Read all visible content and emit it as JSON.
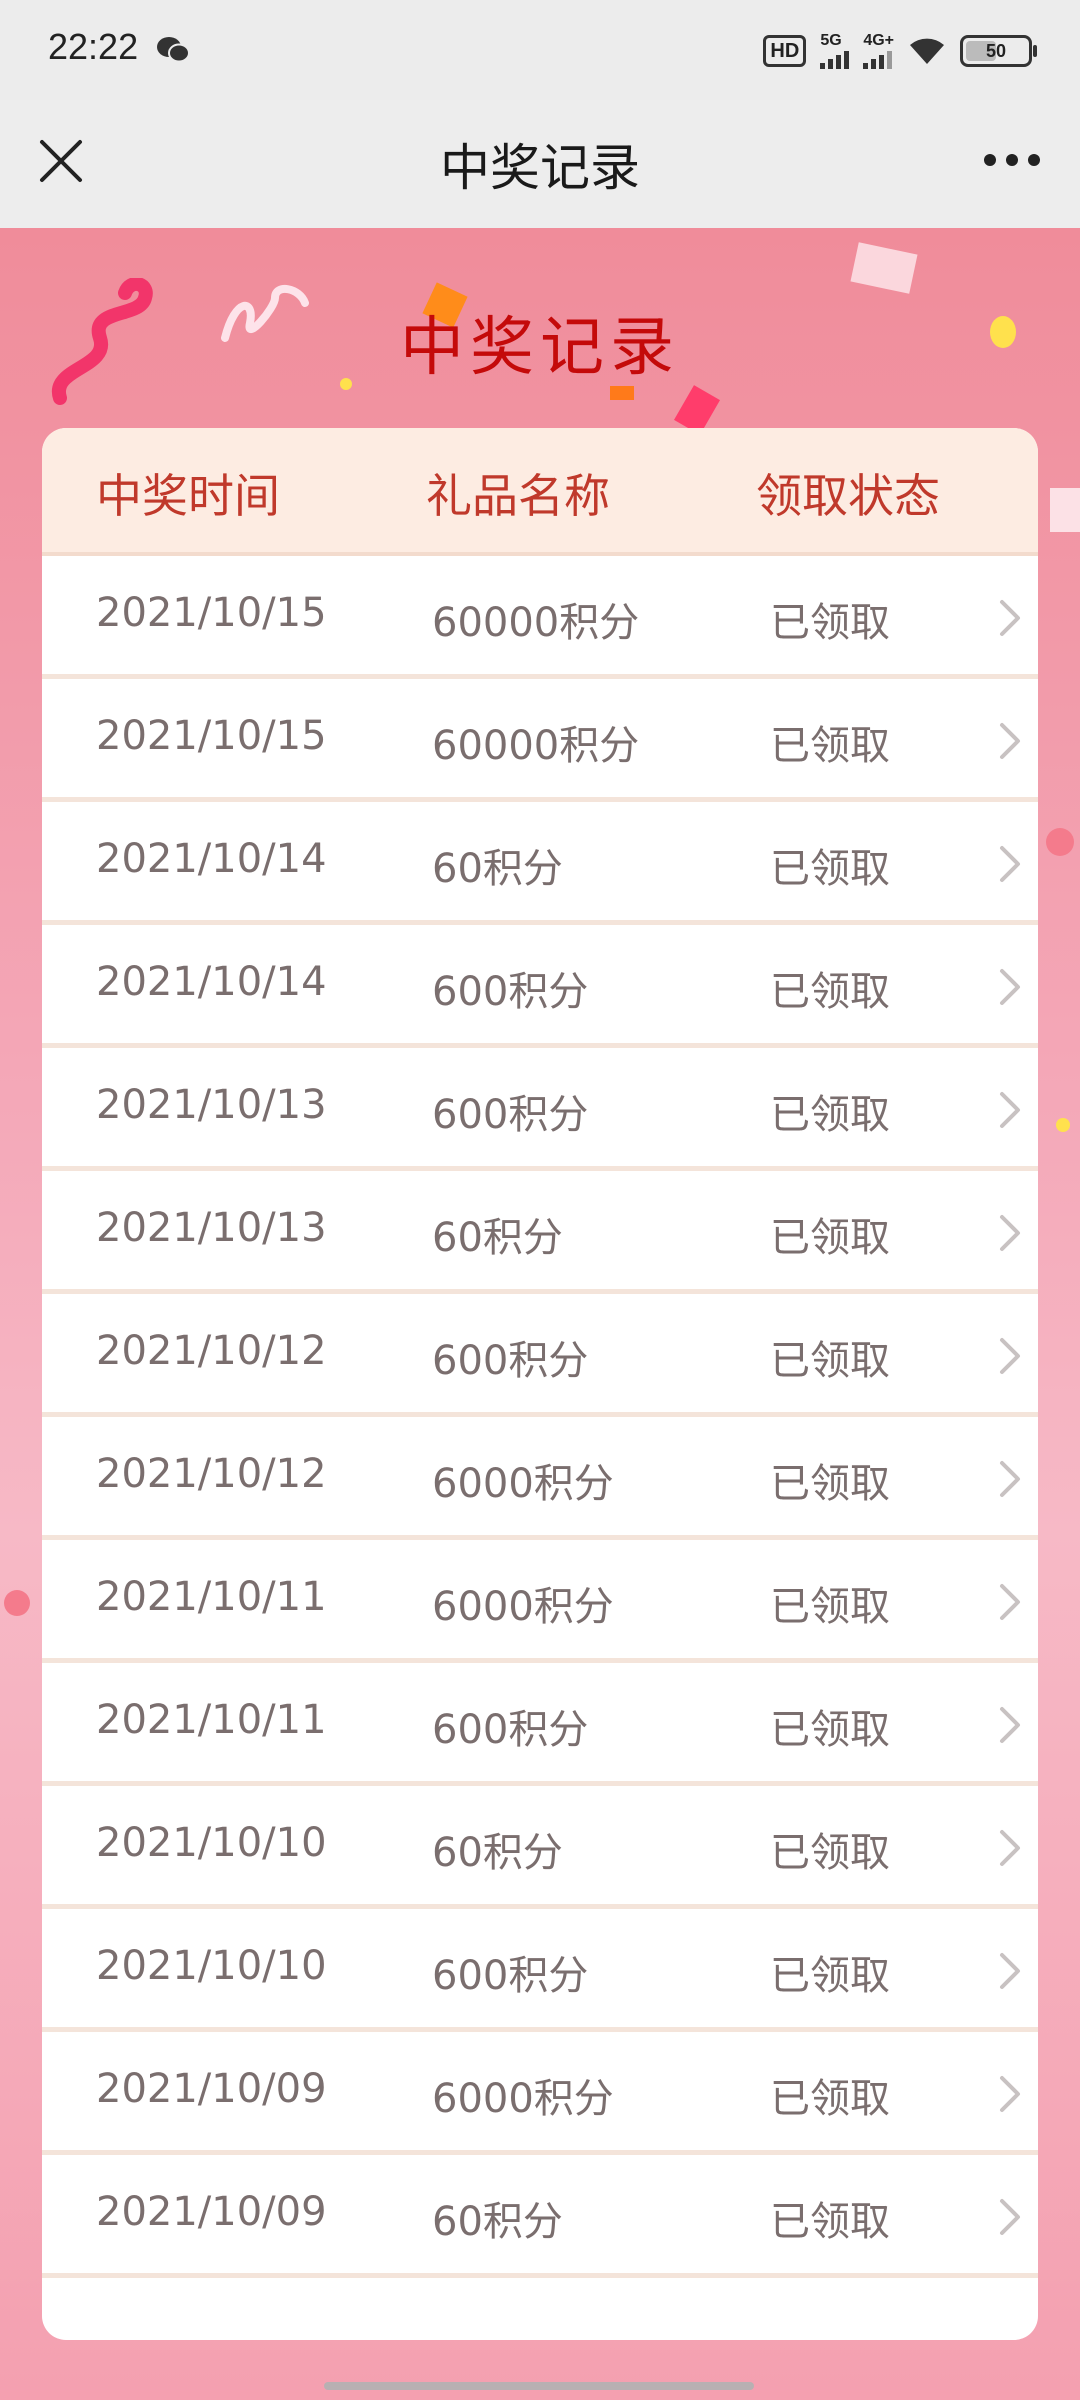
{
  "status_bar": {
    "time": "22:22",
    "hd_label": "HD",
    "network_1": "5G",
    "network_2": "4G+",
    "battery": "50"
  },
  "nav": {
    "title": "中奖记录",
    "close_icon": "close-icon",
    "more_icon": "more-icon"
  },
  "page": {
    "title": "中奖记录"
  },
  "table": {
    "headers": [
      "中奖时间",
      "礼品名称",
      "领取状态"
    ],
    "rows": [
      {
        "date": "2021/10/15",
        "gift": "60000积分",
        "status": "已领取"
      },
      {
        "date": "2021/10/15",
        "gift": "60000积分",
        "status": "已领取"
      },
      {
        "date": "2021/10/14",
        "gift": "60积分",
        "status": "已领取"
      },
      {
        "date": "2021/10/14",
        "gift": "600积分",
        "status": "已领取"
      },
      {
        "date": "2021/10/13",
        "gift": "600积分",
        "status": "已领取"
      },
      {
        "date": "2021/10/13",
        "gift": "60积分",
        "status": "已领取"
      },
      {
        "date": "2021/10/12",
        "gift": "600积分",
        "status": "已领取"
      },
      {
        "date": "2021/10/12",
        "gift": "6000积分",
        "status": "已领取"
      },
      {
        "date": "2021/10/11",
        "gift": "6000积分",
        "status": "已领取"
      },
      {
        "date": "2021/10/11",
        "gift": "600积分",
        "status": "已领取"
      },
      {
        "date": "2021/10/10",
        "gift": "60积分",
        "status": "已领取"
      },
      {
        "date": "2021/10/10",
        "gift": "600积分",
        "status": "已领取"
      },
      {
        "date": "2021/10/09",
        "gift": "6000积分",
        "status": "已领取"
      },
      {
        "date": "2021/10/09",
        "gift": "60积分",
        "status": "已领取"
      }
    ]
  },
  "colors": {
    "title_red": "#c40a0a",
    "header_text": "#c0392b",
    "header_bg": "#fdece2",
    "row_text": "#7a6e6e",
    "page_bg": "#f4a5b4"
  }
}
